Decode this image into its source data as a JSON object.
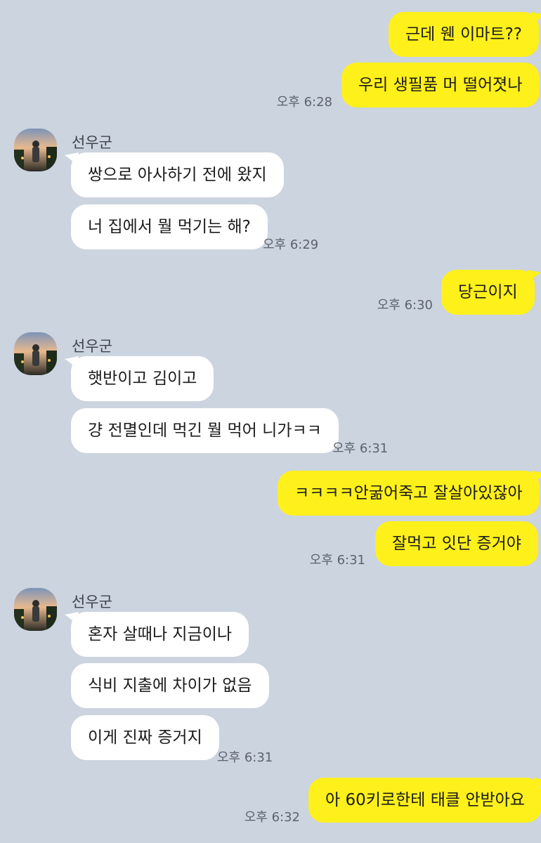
{
  "colors": {
    "background": "#cbd4df",
    "my_bubble": "#fef01b",
    "their_bubble": "#ffffff"
  },
  "contact": {
    "name": "선우군"
  },
  "messages": [
    {
      "from": "me",
      "text": "근데 웬 이마트??"
    },
    {
      "from": "me",
      "text": "우리 생필품 머 떨어졋나",
      "time": "오후 6:28"
    },
    {
      "from": "them",
      "text": "쌍으로 아사하기 전에 왔지"
    },
    {
      "from": "them",
      "text": "너 집에서 뭘 먹기는 해?",
      "time": "오후 6:29"
    },
    {
      "from": "me",
      "text": "당근이지",
      "time": "오후 6:30"
    },
    {
      "from": "them",
      "text": "햇반이고 김이고"
    },
    {
      "from": "them",
      "text": "걍 전멸인데 먹긴 뭘 먹어 니가ㅋㅋ",
      "time": "오후 6:31"
    },
    {
      "from": "me",
      "text": "ㅋㅋㅋㅋ안굶어죽고 잘살아있잖아"
    },
    {
      "from": "me",
      "text": "잘먹고 잇단 증거야",
      "time": "오후 6:31"
    },
    {
      "from": "them",
      "text": "혼자 살때나 지금이나"
    },
    {
      "from": "them",
      "text": "식비 지출에 차이가 없음"
    },
    {
      "from": "them",
      "text": "이게 진짜 증거지",
      "time": "오후 6:31"
    },
    {
      "from": "me",
      "text": "아 60키로한테 태클 안받아요",
      "time": "오후 6:32"
    }
  ]
}
